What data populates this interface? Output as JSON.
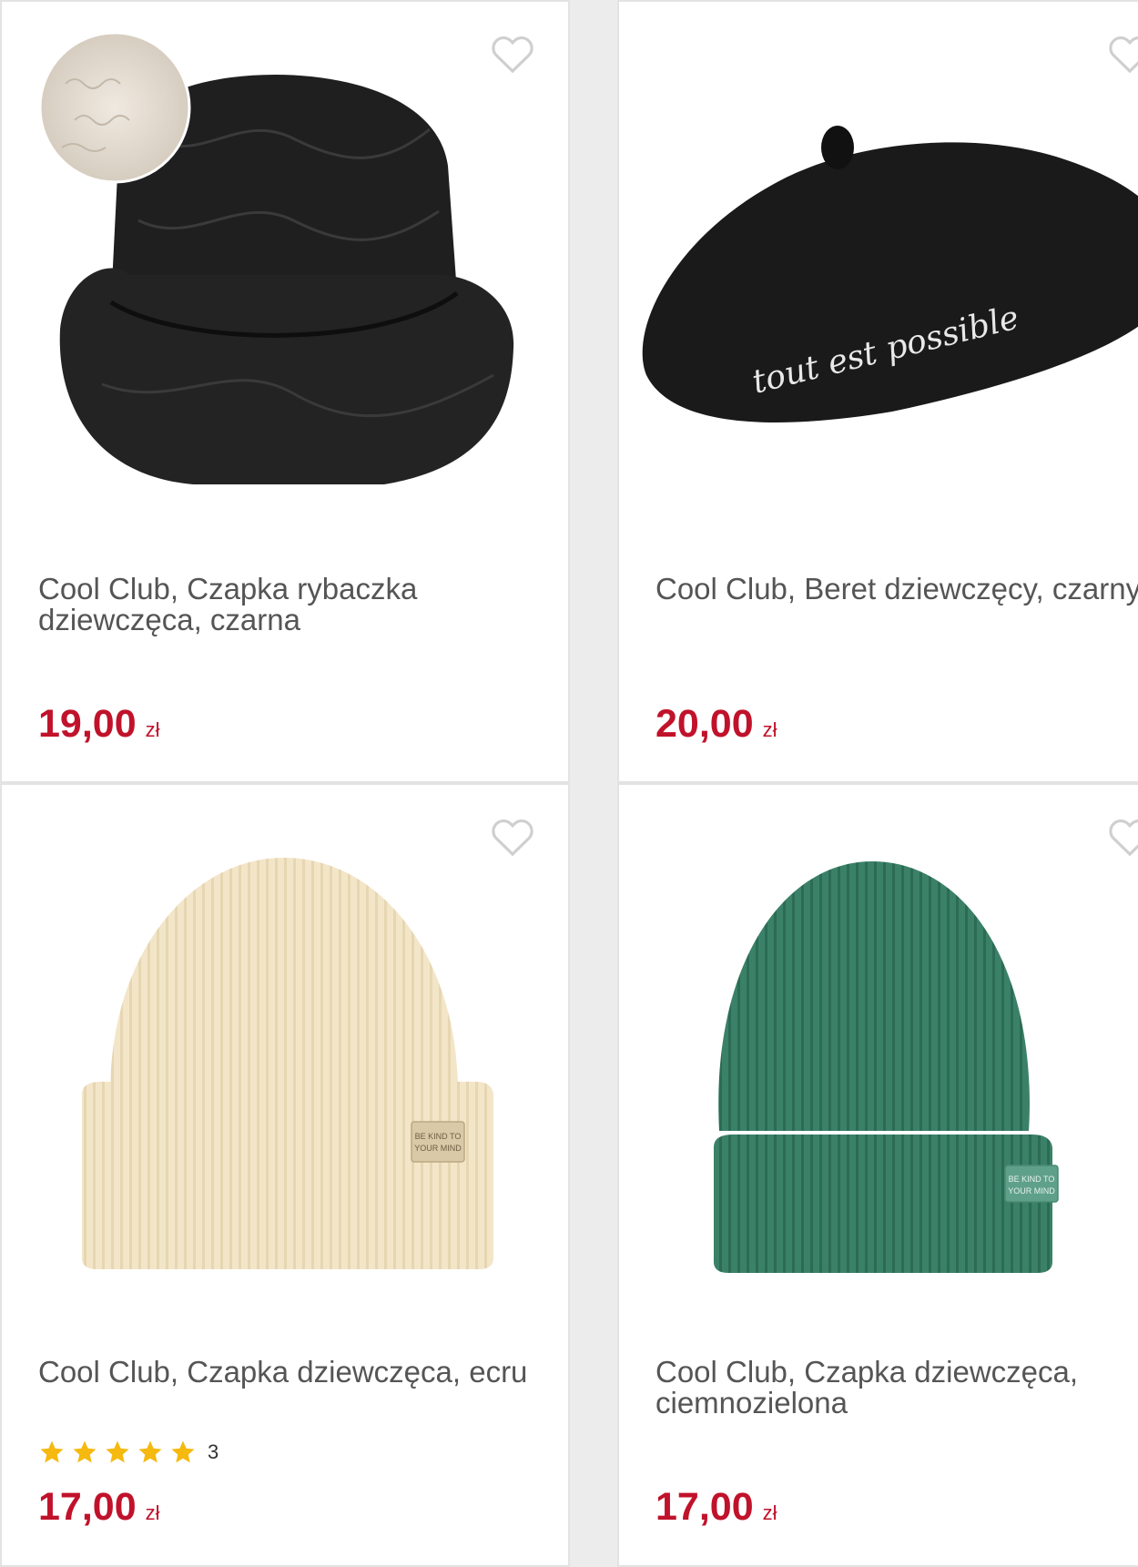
{
  "products": [
    {
      "name": "Cool Club, Czapka rybaczka dziewczęca, czarna",
      "price": "19,00",
      "currency": "zł",
      "image": "black quilted bucket hat"
    },
    {
      "name": "Cool Club, Beret dziewczęcy, czarny",
      "price": "20,00",
      "currency": "zł",
      "image": "black beret",
      "embroidery": "tout est possible"
    },
    {
      "name": "Cool Club, Czapka dziewczęca, ecru",
      "price": "17,00",
      "currency": "zł",
      "image": "ecru knit beanie",
      "rating": {
        "stars": 5,
        "count": "3"
      },
      "tag": "BE KIND TO YOUR MIND"
    },
    {
      "name": "Cool Club, Czapka dziewczęca, ciemnozielona",
      "price": "17,00",
      "currency": "zł",
      "image": "dark green knit beanie",
      "tag": "BE KIND TO YOUR MIND"
    }
  ],
  "colors": {
    "price": "#c1122b",
    "star": "#f5b90f",
    "heart": "#cfcfcf"
  },
  "icons": {
    "favorite": "heart-outline-icon",
    "rating": "star-icon"
  }
}
